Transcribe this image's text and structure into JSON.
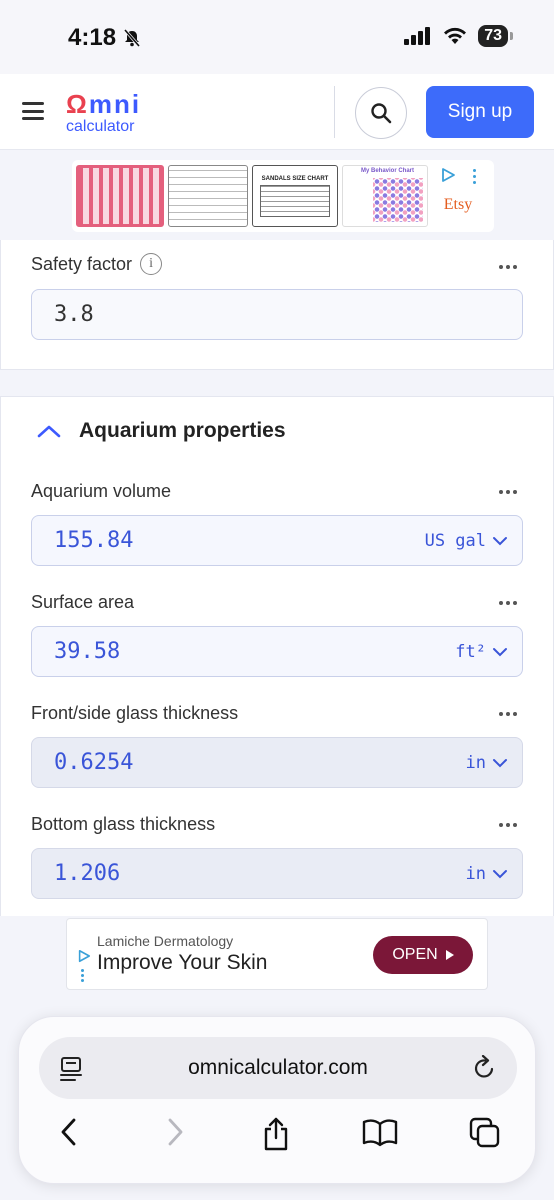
{
  "status_bar": {
    "time": "4:18",
    "battery": "73"
  },
  "header": {
    "logo_word_first": "Ω",
    "logo_word_rest": "mni",
    "logo_sub": "calculator",
    "signup_label": "Sign up"
  },
  "ad_top": {
    "thumb_sandal_title": "SANDALS SIZE CHART",
    "thumb_chart_title": "My Behavior Chart",
    "brand": "Etsy"
  },
  "fields": {
    "safety_factor": {
      "label": "Safety factor",
      "value": "3.8"
    }
  },
  "section": {
    "title": "Aquarium properties"
  },
  "aquarium": [
    {
      "label": "Aquarium volume",
      "value": "155.84",
      "unit": "US gal",
      "style": "blue"
    },
    {
      "label": "Surface area",
      "value": "39.58",
      "unit": "ft²",
      "style": "blue"
    },
    {
      "label": "Front/side glass thickness",
      "value": "0.6254",
      "unit": "in",
      "style": "grey"
    },
    {
      "label": "Bottom glass thickness",
      "value": "1.206",
      "unit": "in",
      "style": "grey"
    }
  ],
  "ad_bottom": {
    "advertiser": "Lamiche Dermatology",
    "headline": "Improve Your Skin",
    "cta": "OPEN"
  },
  "browser": {
    "url": "omnicalculator.com"
  },
  "colors": {
    "accent": "#3d6bfa",
    "logo_red": "#e9414f",
    "value_blue": "#3a55d8",
    "ad_cta": "#7b1738"
  }
}
